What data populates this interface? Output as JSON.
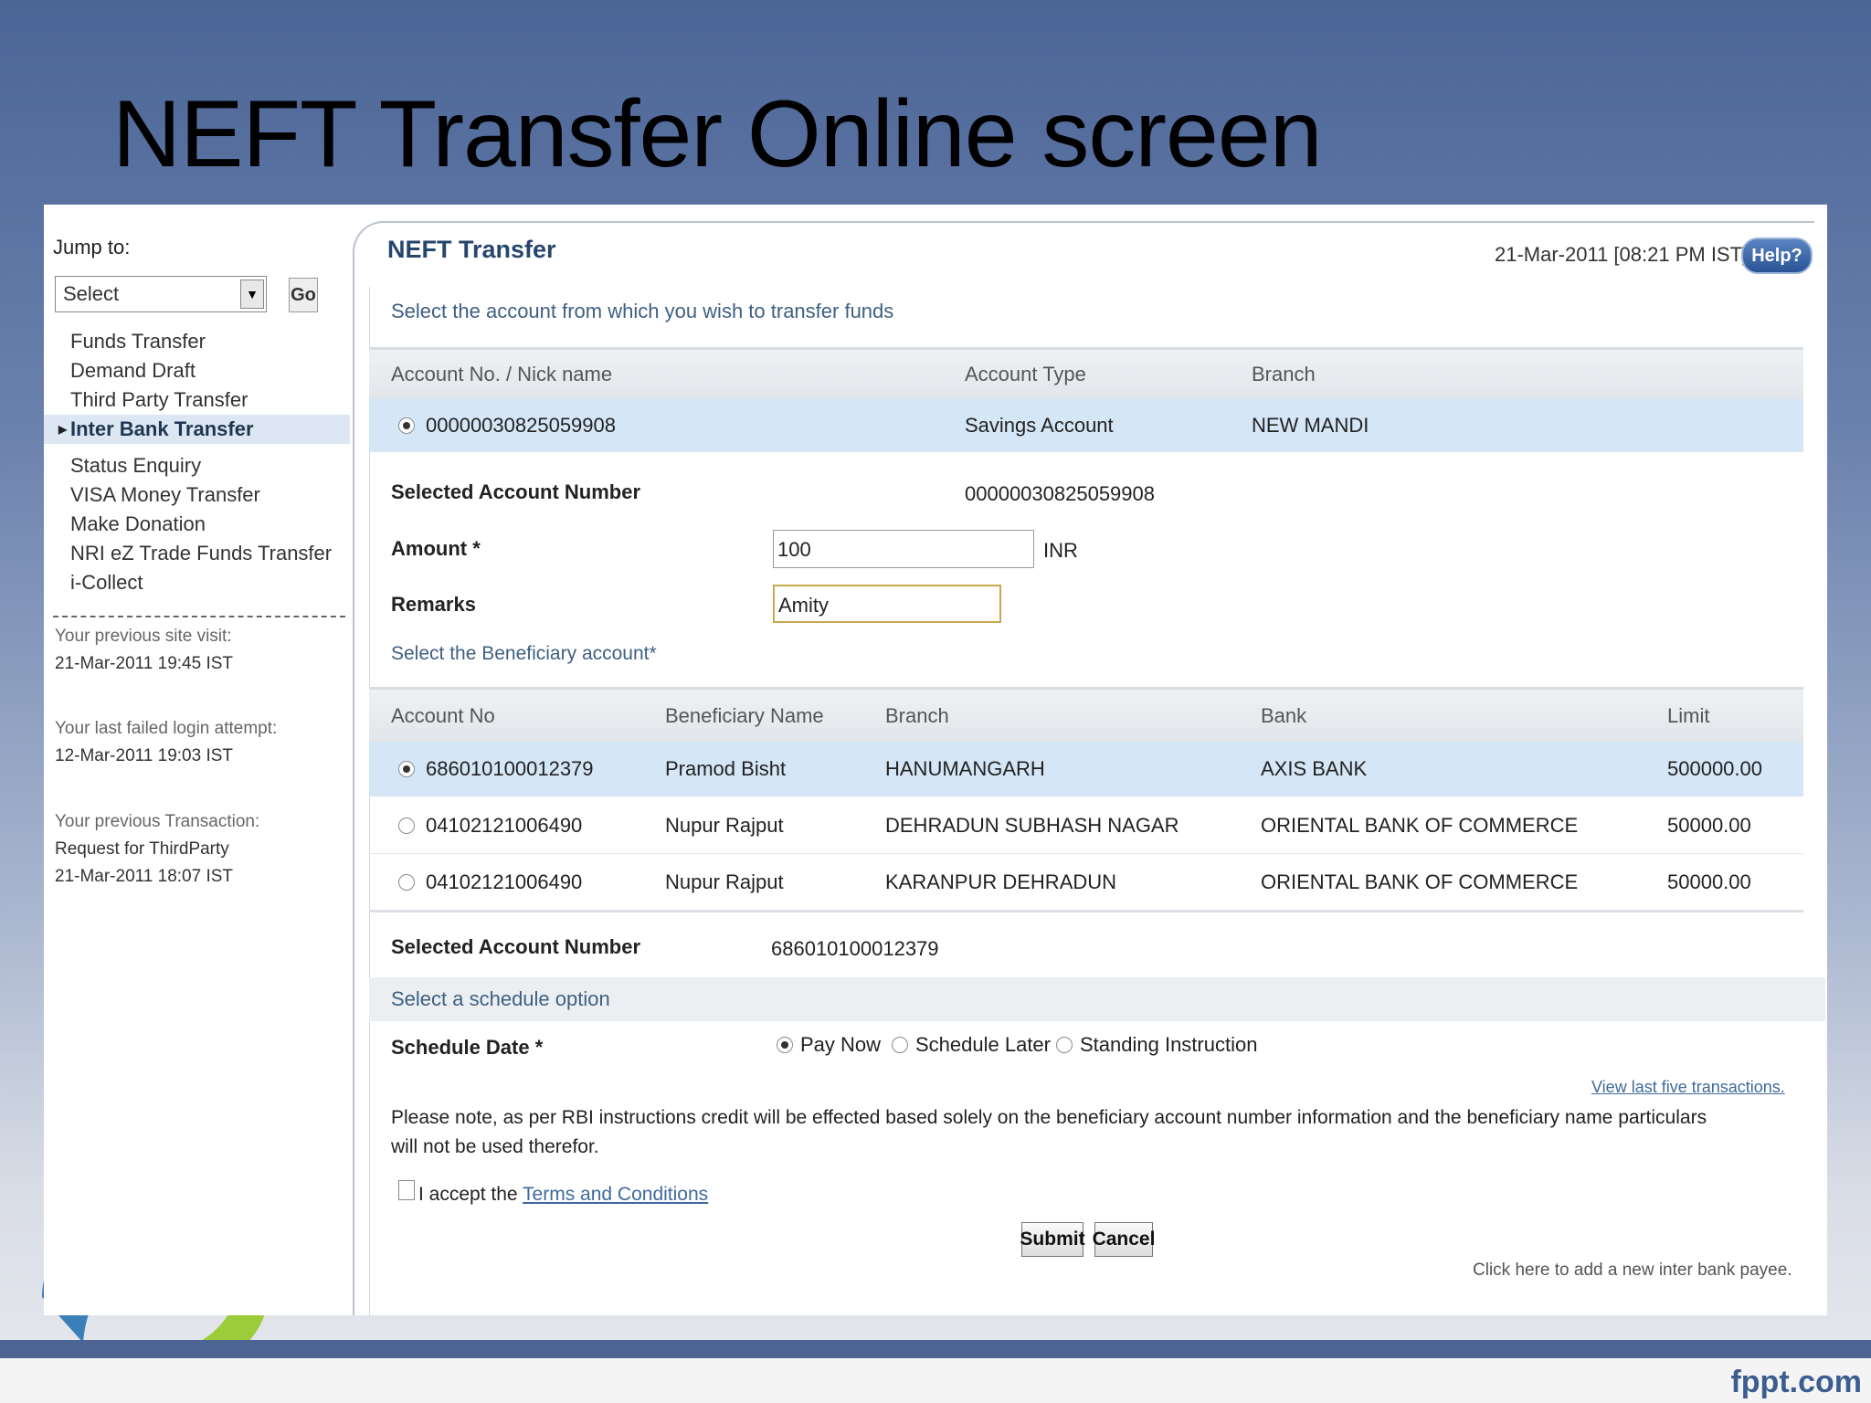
{
  "slide": {
    "title": "NEFT Transfer Online screen",
    "footer_brand": "fppt.com"
  },
  "nav": {
    "jump_label": "Jump to:",
    "select_value": "Select",
    "go_label": "Go",
    "items": [
      {
        "label": "Funds Transfer"
      },
      {
        "label": "Demand Draft"
      },
      {
        "label": "Third Party Transfer"
      },
      {
        "label": "Inter Bank Transfer"
      },
      {
        "label": "Status Enquiry"
      },
      {
        "label": "VISA Money Transfer"
      },
      {
        "label": "Make Donation"
      },
      {
        "label": "NRI eZ Trade Funds Transfer"
      },
      {
        "label": "i-Collect"
      }
    ],
    "active_item": "Inter Bank Transfer",
    "prev_visit_label": "Your previous site visit:",
    "prev_visit_value": "21-Mar-2011 19:45 IST",
    "failed_login_label": "Your last failed login attempt:",
    "failed_login_value": "12-Mar-2011 19:03 IST",
    "prev_txn_label": "Your previous Transaction:",
    "prev_txn_value1": "Request for ThirdParty",
    "prev_txn_value2": "21-Mar-2011 18:07 IST"
  },
  "panel": {
    "title": "NEFT Transfer",
    "datetime": "21-Mar-2011 [08:21 PM IST]",
    "help_label": "Help?",
    "from_prompt": "Select the account from which you wish to transfer funds",
    "src_headers": {
      "account": "Account No. / Nick name",
      "type": "Account Type",
      "branch": "Branch"
    },
    "src_row": {
      "account": "00000030825059908",
      "type": "Savings Account",
      "branch": "NEW MANDI"
    },
    "selected_account_label": "Selected Account Number",
    "selected_account_value": "00000030825059908",
    "amount_label": "Amount *",
    "amount_value": "100",
    "currency": "INR",
    "remarks_label": "Remarks",
    "remarks_value": "Amity",
    "beneficiary_prompt": "Select the Beneficiary account*",
    "ben_headers": {
      "account": "Account No",
      "name": "Beneficiary Name",
      "branch": "Branch",
      "bank": "Bank",
      "limit": "Limit"
    },
    "beneficiaries": [
      {
        "account": "686010100012379",
        "name": "Pramod Bisht",
        "branch": "HANUMANGARH",
        "bank": "AXIS BANK",
        "limit": "500000.00",
        "selected": true
      },
      {
        "account": "04102121006490",
        "name": "Nupur Rajput",
        "branch": "DEHRADUN SUBHASH NAGAR",
        "bank": "ORIENTAL BANK OF COMMERCE",
        "limit": "50000.00",
        "selected": false
      },
      {
        "account": "04102121006490",
        "name": "Nupur Rajput",
        "branch": "KARANPUR DEHRADUN",
        "bank": "ORIENTAL BANK OF COMMERCE",
        "limit": "50000.00",
        "selected": false
      }
    ],
    "selected_ben_label": "Selected Account Number",
    "selected_ben_value": "686010100012379",
    "schedule_prompt": "Select a schedule option",
    "schedule_label": "Schedule Date *",
    "schedule_options": [
      "Pay Now",
      "Schedule Later",
      "Standing Instruction"
    ],
    "schedule_selected": "Pay Now",
    "view_last_link": "View last five transactions.",
    "note_line1": "Please note, as per RBI instructions credit will be effected based solely on the beneficiary account number information and the beneficiary name particulars",
    "note_line2": "will not be used therefor.",
    "accept_prefix": "I accept the",
    "terms_link": "Terms and Conditions",
    "submit_label": "Submit",
    "cancel_label": "Cancel",
    "add_payee_link": "Click here to add a new inter bank payee."
  }
}
